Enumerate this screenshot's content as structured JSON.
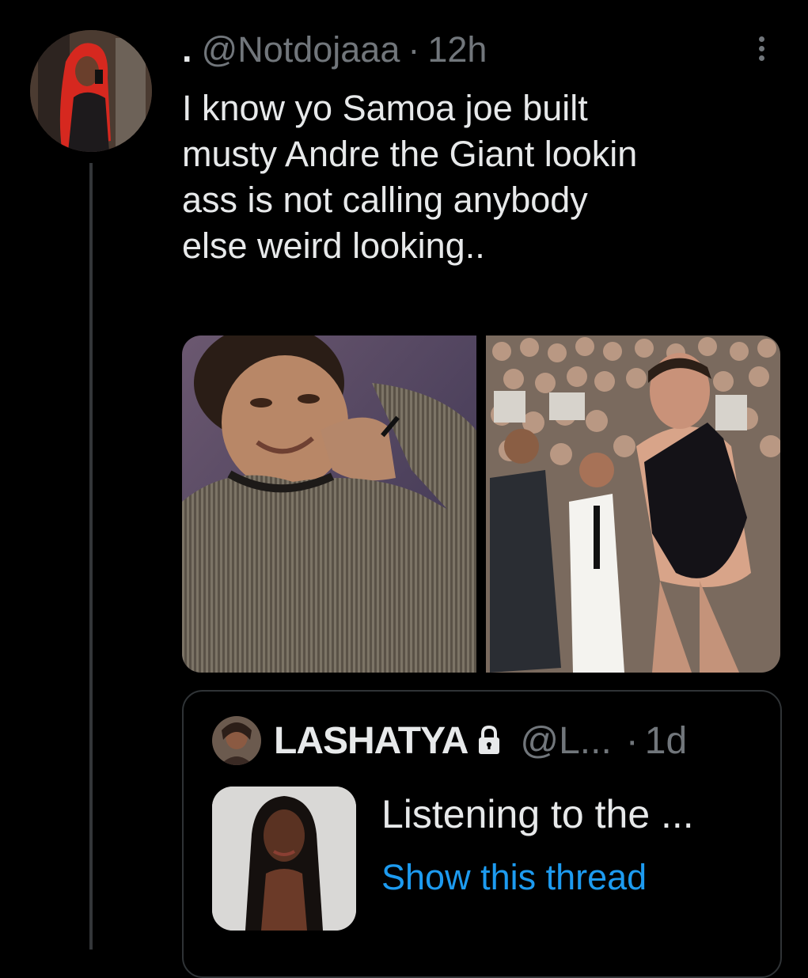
{
  "tweet": {
    "display_name": ".",
    "handle": "@Notdojaaa",
    "separator": "·",
    "time": "12h",
    "text_lines": [
      "I know yo Samoa joe built",
      "musty Andre the Giant lookin",
      "ass is not calling anybody",
      "else weird looking.."
    ],
    "more_icon": "more-options-icon"
  },
  "quote": {
    "name": "LASHATYA",
    "lock_icon": "lock-icon",
    "handle": "@L...",
    "separator": "·",
    "time": "1d",
    "text": "Listening to the ...",
    "show_thread": "Show this thread"
  },
  "colors": {
    "background": "#000000",
    "text_primary": "#e7e9ea",
    "text_secondary": "#71767b",
    "link": "#1d9bf0",
    "border": "#2f3336"
  }
}
